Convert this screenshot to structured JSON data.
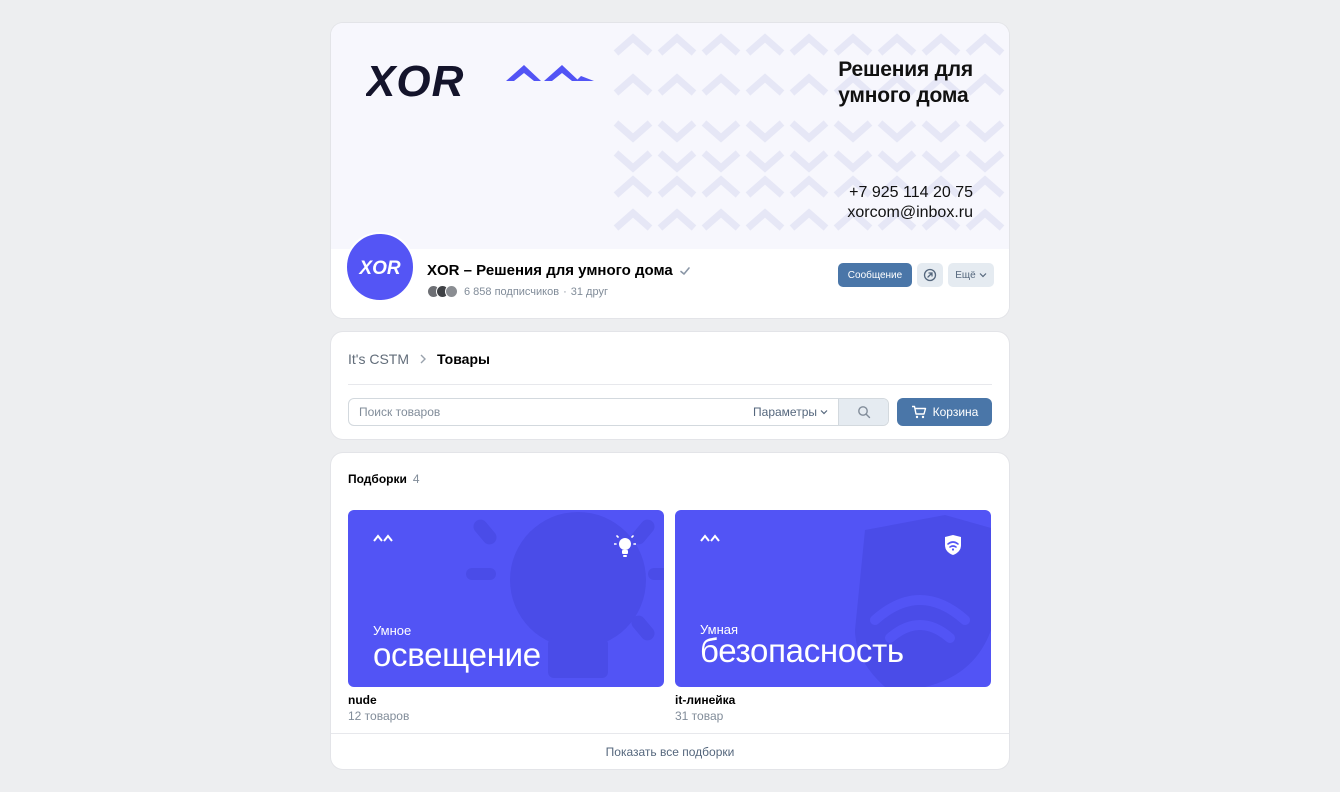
{
  "cover": {
    "brand": "XOR",
    "tagline_line1": "Решения для",
    "tagline_line2": "умного дома",
    "phone": "+7 925 114 20 75",
    "email": "xorcom@inbox.ru"
  },
  "group": {
    "avatar_text": "XOR",
    "name": "XOR – Решения для умного дома",
    "subscribers": "6 858 подписчиков",
    "separator": "·",
    "friends": "31 друг"
  },
  "actions": {
    "message_label": "Сообщение",
    "more_label": "Ещё"
  },
  "shop": {
    "breadcrumb": [
      "It's CSTM",
      "Товары"
    ],
    "search_placeholder": "Поиск товаров",
    "params_label": "Параметры",
    "cart_label": "Корзина"
  },
  "collections": {
    "title": "Подборки",
    "count": "4",
    "items": [
      {
        "small": "Умное",
        "big": "освещение",
        "name": "nude",
        "count": "12 товаров"
      },
      {
        "small": "Умная",
        "big": "безопасность",
        "name": "it-линейка",
        "count": "31 товар"
      }
    ],
    "show_all": "Показать все подборки"
  },
  "colors": {
    "brand_purple": "#5254f5",
    "vk_blue": "#4a76a8",
    "page_bg": "#edeef0"
  }
}
